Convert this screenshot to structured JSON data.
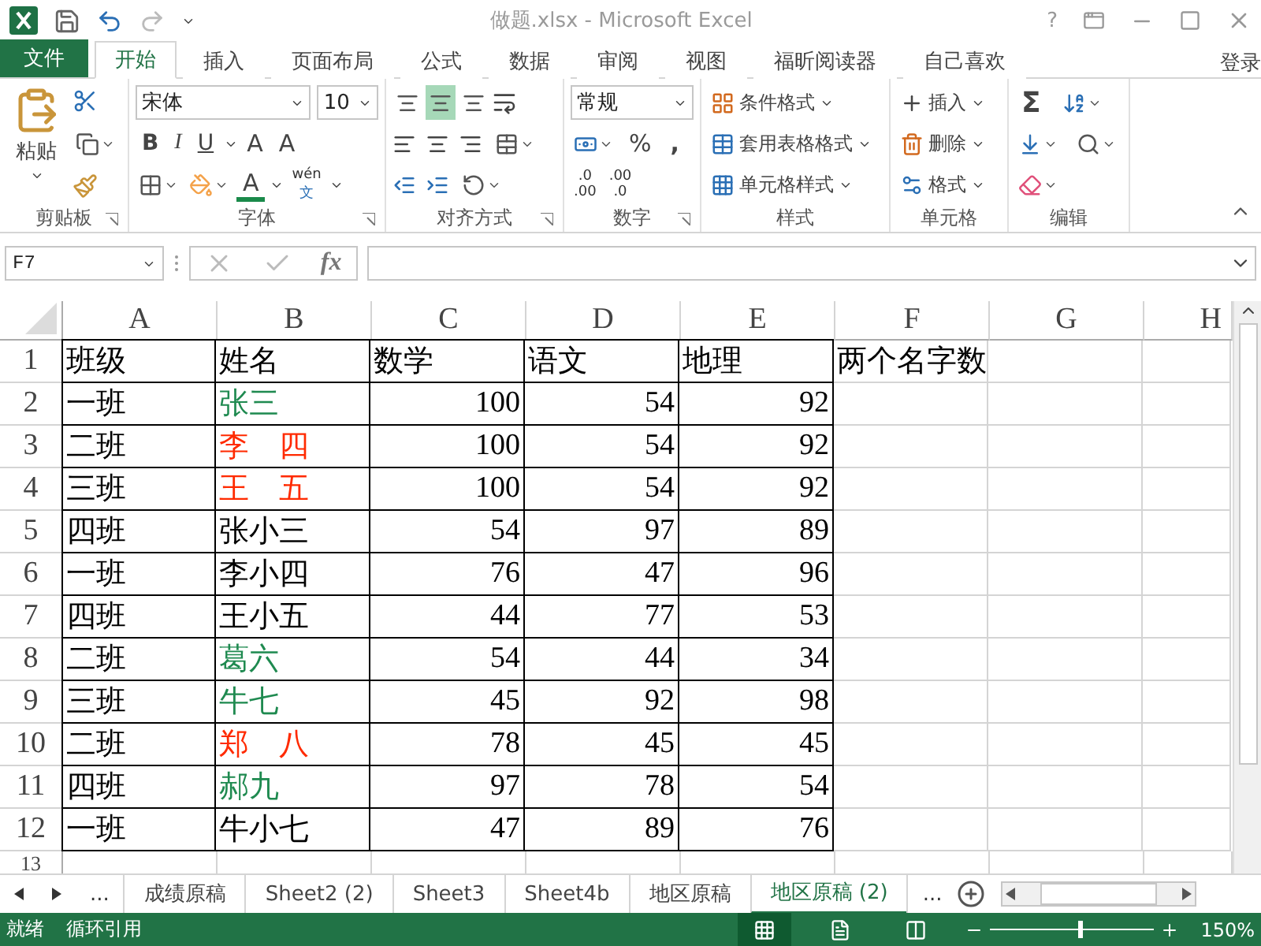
{
  "window": {
    "title": "做题.xlsx - Microsoft Excel",
    "help": "?"
  },
  "ribbon_tabs": [
    {
      "label": "文件",
      "kind": "file",
      "selected": false
    },
    {
      "label": "开始",
      "kind": "tab",
      "selected": true
    },
    {
      "label": "插入",
      "kind": "tab",
      "selected": false
    },
    {
      "label": "页面布局",
      "kind": "tab",
      "selected": false
    },
    {
      "label": "公式",
      "kind": "tab",
      "selected": false
    },
    {
      "label": "数据",
      "kind": "tab",
      "selected": false
    },
    {
      "label": "审阅",
      "kind": "tab",
      "selected": false
    },
    {
      "label": "视图",
      "kind": "tab",
      "selected": false
    },
    {
      "label": "福昕阅读器",
      "kind": "tab",
      "selected": false
    },
    {
      "label": "自己喜欢",
      "kind": "tab",
      "selected": false
    }
  ],
  "sign_in": "登录",
  "ribbon": {
    "clipboard": {
      "label": "剪贴板",
      "paste": "粘贴"
    },
    "font": {
      "label": "字体",
      "font_name": "宋体",
      "font_size": "10",
      "style_buttons": [
        "B",
        "I",
        "U"
      ],
      "size_buttons": [
        "A",
        "A"
      ],
      "font_color_button": "A",
      "phonetic_top": "wén",
      "phonetic_bottom": "文"
    },
    "alignment": {
      "label": "对齐方式",
      "vertical_align": [
        {
          "selected": false
        },
        {
          "selected": true
        },
        {
          "selected": false
        }
      ]
    },
    "number": {
      "label": "数字",
      "format": "常规",
      "percent": "%",
      "comma": ",",
      "decimal_buttons": [
        {
          "top": ".0",
          "bottom": ".00"
        },
        {
          "top": ".00",
          "bottom": ".0"
        }
      ]
    },
    "styles": {
      "label": "样式",
      "items": [
        "条件格式",
        "套用表格格式",
        "单元格样式"
      ]
    },
    "cells": {
      "label": "单元格",
      "items": [
        "插入",
        "删除",
        "格式"
      ]
    },
    "editing": {
      "label": "编辑",
      "sum": "Σ"
    }
  },
  "formula_bar": {
    "name_box": "F7",
    "function_label": "fx"
  },
  "sheet": {
    "columns": [
      "A",
      "B",
      "C",
      "D",
      "E",
      "F",
      "G",
      "H"
    ],
    "rows": [
      {
        "header": "1",
        "cells": [
          {
            "text": "班级",
            "bordered": true
          },
          {
            "text": "姓名",
            "bordered": true
          },
          {
            "text": "数学",
            "bordered": true
          },
          {
            "text": "语文",
            "bordered": true
          },
          {
            "text": "地理",
            "bordered": true
          },
          {
            "text": "两个名字数",
            "bordered": false
          }
        ]
      },
      {
        "header": "2",
        "cells": [
          {
            "text": "一班",
            "bordered": true
          },
          {
            "text": "张三",
            "color": "#1f8a50",
            "bordered": true
          },
          {
            "text": "100",
            "kind": "number",
            "bordered": true
          },
          {
            "text": "54",
            "kind": "number",
            "bordered": true
          },
          {
            "text": "92",
            "kind": "number",
            "bordered": true
          }
        ]
      },
      {
        "header": "3",
        "cells": [
          {
            "text": "二班",
            "bordered": true
          },
          {
            "text": "李　四",
            "color": "#ff2a00",
            "bordered": true
          },
          {
            "text": "100",
            "kind": "number",
            "bordered": true
          },
          {
            "text": "54",
            "kind": "number",
            "bordered": true
          },
          {
            "text": "92",
            "kind": "number",
            "bordered": true
          }
        ]
      },
      {
        "header": "4",
        "cells": [
          {
            "text": "三班",
            "bordered": true
          },
          {
            "text": "王　五",
            "color": "#ff2a00",
            "bordered": true
          },
          {
            "text": "100",
            "kind": "number",
            "bordered": true
          },
          {
            "text": "54",
            "kind": "number",
            "bordered": true
          },
          {
            "text": "92",
            "kind": "number",
            "bordered": true
          }
        ]
      },
      {
        "header": "5",
        "cells": [
          {
            "text": "四班",
            "bordered": true
          },
          {
            "text": "张小三",
            "bordered": true
          },
          {
            "text": "54",
            "kind": "number",
            "bordered": true
          },
          {
            "text": "97",
            "kind": "number",
            "bordered": true
          },
          {
            "text": "89",
            "kind": "number",
            "bordered": true
          }
        ]
      },
      {
        "header": "6",
        "cells": [
          {
            "text": "一班",
            "bordered": true
          },
          {
            "text": "李小四",
            "bordered": true
          },
          {
            "text": "76",
            "kind": "number",
            "bordered": true
          },
          {
            "text": "47",
            "kind": "number",
            "bordered": true
          },
          {
            "text": "96",
            "kind": "number",
            "bordered": true
          }
        ]
      },
      {
        "header": "7",
        "cells": [
          {
            "text": "四班",
            "bordered": true
          },
          {
            "text": "王小五",
            "bordered": true
          },
          {
            "text": "44",
            "kind": "number",
            "bordered": true
          },
          {
            "text": "77",
            "kind": "number",
            "bordered": true
          },
          {
            "text": "53",
            "kind": "number",
            "bordered": true
          }
        ]
      },
      {
        "header": "8",
        "cells": [
          {
            "text": "二班",
            "bordered": true
          },
          {
            "text": "葛六",
            "color": "#1f8a50",
            "bordered": true
          },
          {
            "text": "54",
            "kind": "number",
            "bordered": true
          },
          {
            "text": "44",
            "kind": "number",
            "bordered": true
          },
          {
            "text": "34",
            "kind": "number",
            "bordered": true
          }
        ]
      },
      {
        "header": "9",
        "cells": [
          {
            "text": "三班",
            "bordered": true
          },
          {
            "text": "牛七",
            "color": "#1f8a50",
            "bordered": true
          },
          {
            "text": "45",
            "kind": "number",
            "bordered": true
          },
          {
            "text": "92",
            "kind": "number",
            "bordered": true
          },
          {
            "text": "98",
            "kind": "number",
            "bordered": true
          }
        ]
      },
      {
        "header": "10",
        "cells": [
          {
            "text": "二班",
            "bordered": true
          },
          {
            "text": "郑　八",
            "color": "#ff2a00",
            "bordered": true
          },
          {
            "text": "78",
            "kind": "number",
            "bordered": true
          },
          {
            "text": "45",
            "kind": "number",
            "bordered": true
          },
          {
            "text": "45",
            "kind": "number",
            "bordered": true
          }
        ]
      },
      {
        "header": "11",
        "cells": [
          {
            "text": "四班",
            "bordered": true
          },
          {
            "text": "郝九",
            "color": "#1f8a50",
            "bordered": true
          },
          {
            "text": "97",
            "kind": "number",
            "bordered": true
          },
          {
            "text": "78",
            "kind": "number",
            "bordered": true
          },
          {
            "text": "54",
            "kind": "number",
            "bordered": true
          }
        ]
      },
      {
        "header": "12",
        "cells": [
          {
            "text": "一班",
            "bordered": true
          },
          {
            "text": "牛小七",
            "bordered": true
          },
          {
            "text": "47",
            "kind": "number",
            "bordered": true
          },
          {
            "text": "89",
            "kind": "number",
            "bordered": true
          },
          {
            "text": "76",
            "kind": "number",
            "bordered": true
          }
        ]
      },
      {
        "header": "13"
      }
    ]
  },
  "sheet_tabs": {
    "more_left": "...",
    "more_right": "...",
    "tabs": [
      {
        "label": "成绩原稿",
        "selected": false
      },
      {
        "label": "Sheet2  (2)",
        "selected": false
      },
      {
        "label": "Sheet3",
        "selected": false
      },
      {
        "label": "Sheet4b",
        "selected": false
      },
      {
        "label": "地区原稿",
        "selected": false
      },
      {
        "label": "地区原稿 (2)",
        "selected": true
      }
    ]
  },
  "status_bar": {
    "status": "就绪",
    "circular_reference": "循环引用",
    "zoom": {
      "level": 0.56,
      "reading": "150%"
    }
  }
}
